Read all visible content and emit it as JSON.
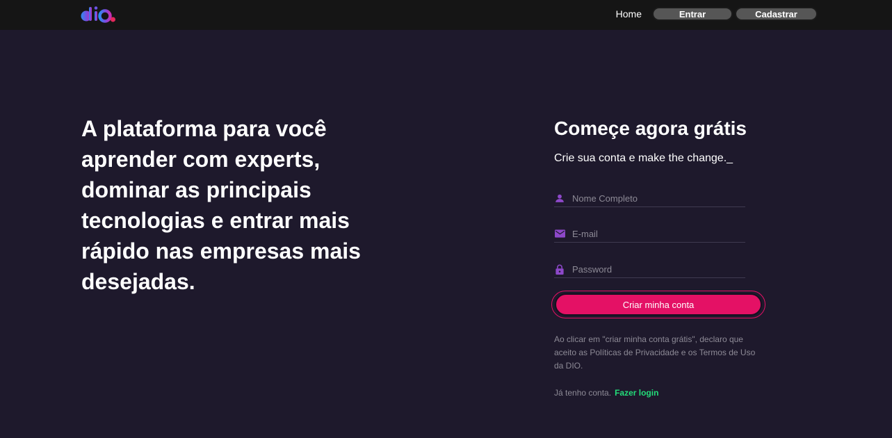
{
  "header": {
    "logo_text": "dio.",
    "nav": {
      "home_label": "Home",
      "login_label": "Entrar",
      "register_label": "Cadastrar"
    }
  },
  "hero": {
    "headline": "A plataforma para você aprender com experts, dominar as principais tecnologias e entrar mais rápido nas empresas mais desejadas."
  },
  "signup": {
    "title": "Começe agora grátis",
    "subtitle": "Crie sua conta e make the change._",
    "fields": [
      {
        "icon": "person-icon",
        "placeholder": "Nome Completo",
        "value": ""
      },
      {
        "icon": "mail-icon",
        "placeholder": "E-mail",
        "value": ""
      },
      {
        "icon": "lock-icon",
        "placeholder": "Password",
        "value": ""
      }
    ],
    "submit_label": "Criar minha conta",
    "terms": "Ao clicar em \"criar minha conta grátis\", declaro que aceito as Políticas de Privacidade e os Termos de Uso da DIO.",
    "have_account_text": "Já tenho conta.",
    "login_link_label": "Fazer login"
  },
  "colors": {
    "background": "#1e192c",
    "topbar": "#151515",
    "accent_pink": "#e41165",
    "icon_purple": "#8d48c9",
    "link_green": "#23dd7a"
  }
}
